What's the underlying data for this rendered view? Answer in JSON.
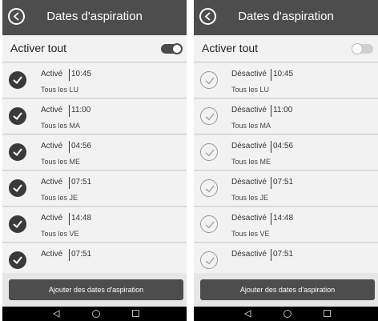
{
  "screens": [
    {
      "title": "Dates d'aspiration",
      "toggle": {
        "label": "Activer tout",
        "state": "on"
      },
      "entries": [
        {
          "status": "Activé",
          "time": "10:45",
          "days": "Tous les LU"
        },
        {
          "status": "Activé",
          "time": "11:00",
          "days": "Tous les MA"
        },
        {
          "status": "Activé",
          "time": "04:56",
          "days": "Tous les ME"
        },
        {
          "status": "Activé",
          "time": "07:51",
          "days": "Tous les JE"
        },
        {
          "status": "Activé",
          "time": "14:48",
          "days": "Tous les VE"
        },
        {
          "status": "Activé",
          "time": "07:51",
          "days": ""
        }
      ],
      "add_button": "Ajouter des dates d'aspiration"
    },
    {
      "title": "Dates d'aspiration",
      "toggle": {
        "label": "Activer tout",
        "state": "off"
      },
      "entries": [
        {
          "status": "Désactivé",
          "time": "10:45",
          "days": "Tous les LU"
        },
        {
          "status": "Désactivé",
          "time": "11:00",
          "days": "Tous les MA"
        },
        {
          "status": "Désactivé",
          "time": "04:56",
          "days": "Tous les ME"
        },
        {
          "status": "Désactivé",
          "time": "07:51",
          "days": "Tous les JE"
        },
        {
          "status": "Désactivé",
          "time": "14:48",
          "days": "Tous les VE"
        },
        {
          "status": "Désactivé",
          "time": "07:51",
          "days": ""
        }
      ],
      "add_button": "Ajouter des dates d'aspiration"
    }
  ],
  "icons": {
    "back": "back-arrow-icon",
    "check": "check-icon",
    "nav_back": "triangle-back-icon",
    "nav_home": "circle-home-icon",
    "nav_recents": "square-recents-icon"
  },
  "colors": {
    "header": "#4d4d4d",
    "row_background": "#f2f2f2",
    "check_active": "#3a3a3a",
    "check_inactive": "#9a9a9a",
    "navbar": "#000000"
  }
}
